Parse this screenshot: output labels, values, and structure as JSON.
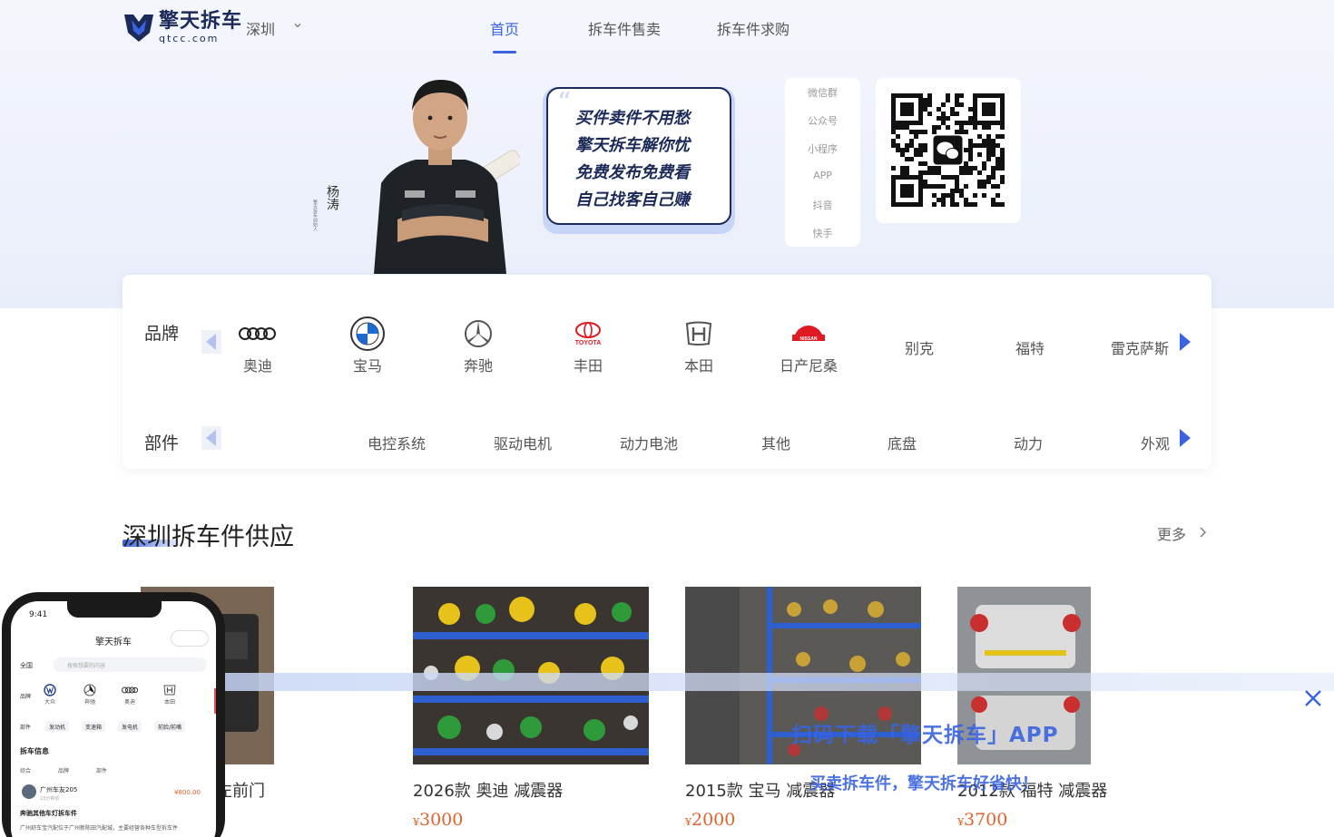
{
  "header": {
    "logo_cn": "擎天拆车",
    "logo_en": "qtcc.com",
    "city": "深圳",
    "nav": [
      {
        "label": "首页",
        "active": true
      },
      {
        "label": "拆车件售卖",
        "active": false
      },
      {
        "label": "拆车件求购",
        "active": false
      }
    ]
  },
  "banner": {
    "signature": "杨涛",
    "signature_sub": "擎天拆车创始人",
    "slogans": [
      "买件卖件不用愁",
      "擎天拆车解你忧",
      "免费发布免费看",
      "自己找客自己赚"
    ],
    "channels": [
      "微信群",
      "公众号",
      "小程序",
      "APP",
      "抖音",
      "快手"
    ],
    "qr_icon": "wechat-icon"
  },
  "filters": {
    "brand_label": "品牌",
    "brands": [
      {
        "name": "奥迪",
        "icon": "audi-logo-icon"
      },
      {
        "name": "宝马",
        "icon": "bmw-logo-icon"
      },
      {
        "name": "奔驰",
        "icon": "mercedes-logo-icon"
      },
      {
        "name": "丰田",
        "icon": "toyota-logo-icon"
      },
      {
        "name": "本田",
        "icon": "honda-logo-icon"
      },
      {
        "name": "日产尼桑",
        "icon": "nissan-logo-icon"
      },
      {
        "name": "别克"
      },
      {
        "name": "福特"
      },
      {
        "name": "雷克萨斯"
      }
    ],
    "part_label": "部件",
    "parts": [
      "电控系统",
      "驱动电机",
      "动力电池",
      "其他",
      "底盘",
      "动力",
      "外观"
    ],
    "toyota_text": "TOYOTA",
    "nissan_text": "NISSAN"
  },
  "section": {
    "title": "深圳拆车件供应",
    "more": "更多",
    "products": [
      {
        "title": "左前门",
        "price": "",
        "currency": "¥"
      },
      {
        "title": "2026款 奥迪 减震器",
        "price": "3000",
        "currency": "¥"
      },
      {
        "title": "2015款 宝马 减震器",
        "price": "2000",
        "currency": "¥"
      },
      {
        "title": "2012款 福特 减震器",
        "price": "3700",
        "currency": "¥"
      }
    ]
  },
  "download": {
    "title": "扫码下载「擎天拆车」APP",
    "subtitle": "买卖拆车件，擎天拆车好省快！"
  },
  "phone": {
    "time": "9:41",
    "title": "擎天拆车",
    "region": "全国",
    "search_placeholder": "搜索想要的内容",
    "brand_label": "品牌",
    "brands": [
      "大众",
      "奔驰",
      "奥迪",
      "本田"
    ],
    "part_label": "部件",
    "parts": [
      "发动机",
      "变速箱",
      "发电机",
      "前脸/前嘴"
    ],
    "section": "拆车信息",
    "filters": [
      "综合",
      "品牌",
      "部件"
    ],
    "user": "广州车友205",
    "user_time": "23分钟前",
    "price": "¥800.00",
    "post_title": "奔驰其他车灯拆车件",
    "post_desc": "广州舒车宝汽配位于广州新陈田汽配城，主要经营各种车型拆车件"
  },
  "colors": {
    "accent": "#3a63e0",
    "price": "#e0622d",
    "navy": "#1b2a59"
  }
}
